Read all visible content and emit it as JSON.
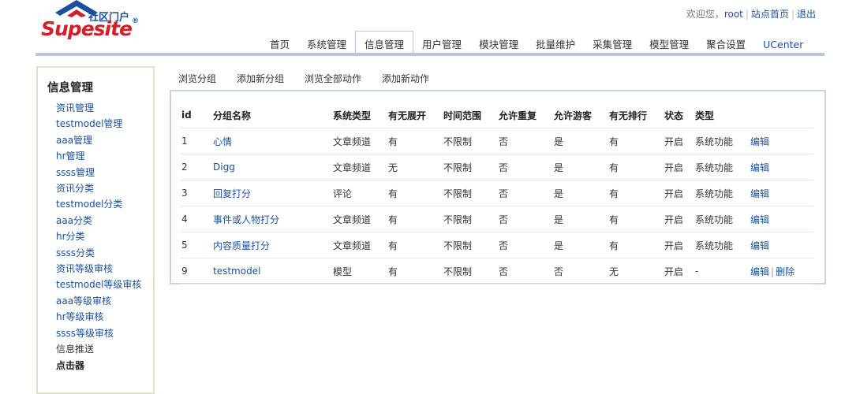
{
  "logo": {
    "subtitle": "社区门户",
    "brand": "Supesite",
    "reg": "®"
  },
  "userbar": {
    "greeting": "欢迎您，",
    "user": "root",
    "site_home": "站点首页",
    "logout": "退出"
  },
  "nav": {
    "tabs": [
      {
        "label": "首页"
      },
      {
        "label": "系统管理"
      },
      {
        "label": "信息管理"
      },
      {
        "label": "用户管理"
      },
      {
        "label": "模块管理"
      },
      {
        "label": "批量维护"
      },
      {
        "label": "采集管理"
      },
      {
        "label": "模型管理"
      },
      {
        "label": "聚合设置"
      },
      {
        "label": "UCenter"
      }
    ],
    "active": "信息管理"
  },
  "sidebar": {
    "title": "信息管理",
    "items": [
      {
        "label": "资讯管理"
      },
      {
        "label": "testmodel管理"
      },
      {
        "label": "aaa管理"
      },
      {
        "label": "hr管理"
      },
      {
        "label": "ssss管理"
      },
      {
        "label": "资讯分类"
      },
      {
        "label": "testmodel分类"
      },
      {
        "label": "aaa分类"
      },
      {
        "label": "hr分类"
      },
      {
        "label": "ssss分类"
      },
      {
        "label": "资讯等级审核"
      },
      {
        "label": "testmodel等级审核"
      },
      {
        "label": "aaa等级审核"
      },
      {
        "label": "hr等级审核"
      },
      {
        "label": "ssss等级审核"
      },
      {
        "label": "信息推送"
      },
      {
        "label": "点击器"
      }
    ]
  },
  "subnav": {
    "items": [
      {
        "label": "浏览分组"
      },
      {
        "label": "添加新分组"
      },
      {
        "label": "浏览全部动作"
      },
      {
        "label": "添加新动作"
      }
    ]
  },
  "table": {
    "headers": [
      "id",
      "分组名称",
      "系统类型",
      "有无展开",
      "时间范围",
      "允许重复",
      "允许游客",
      "有无排行",
      "状态",
      "类型",
      ""
    ],
    "rows": [
      {
        "id": "1",
        "name": "心情",
        "systype": "文章频道",
        "expand": "有",
        "range": "不限制",
        "repeat": "否",
        "guest": "是",
        "rank": "有",
        "status": "开启",
        "type": "系统功能",
        "edit": "编辑",
        "del": ""
      },
      {
        "id": "2",
        "name": "Digg",
        "systype": "文章频道",
        "expand": "无",
        "range": "不限制",
        "repeat": "否",
        "guest": "是",
        "rank": "有",
        "status": "开启",
        "type": "系统功能",
        "edit": "编辑",
        "del": ""
      },
      {
        "id": "3",
        "name": "回复打分",
        "systype": "评论",
        "expand": "有",
        "range": "不限制",
        "repeat": "否",
        "guest": "是",
        "rank": "有",
        "status": "开启",
        "type": "系统功能",
        "edit": "编辑",
        "del": ""
      },
      {
        "id": "4",
        "name": "事件或人物打分",
        "systype": "文章频道",
        "expand": "有",
        "range": "不限制",
        "repeat": "否",
        "guest": "是",
        "rank": "有",
        "status": "开启",
        "type": "系统功能",
        "edit": "编辑",
        "del": ""
      },
      {
        "id": "5",
        "name": "内容质量打分",
        "systype": "文章频道",
        "expand": "有",
        "range": "不限制",
        "repeat": "否",
        "guest": "是",
        "rank": "有",
        "status": "开启",
        "type": "系统功能",
        "edit": "编辑",
        "del": ""
      },
      {
        "id": "9",
        "name": "testmodel",
        "systype": "模型",
        "expand": "有",
        "range": "不限制",
        "repeat": "否",
        "guest": "否",
        "rank": "无",
        "status": "开启",
        "type": "-",
        "edit": "编辑",
        "del": "删除"
      }
    ]
  },
  "colors": {
    "link": "#1b4f9b",
    "brand_red": "#d21f2b",
    "nav_line": "#b9c6de",
    "sidebar_border": "#dde4c8"
  }
}
